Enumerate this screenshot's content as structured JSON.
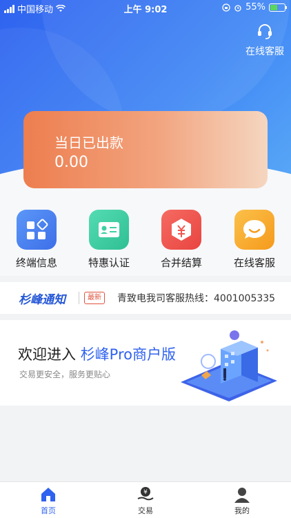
{
  "status_bar": {
    "carrier": "中国移动",
    "time": "上午 9:02",
    "battery": "55%",
    "battery_level": 0.55
  },
  "header": {
    "service_label": "在线客服"
  },
  "balance_card": {
    "title": "当日已出款",
    "amount": "0.00"
  },
  "quick_actions": [
    {
      "label": "终端信息",
      "icon": "grid-icon",
      "color": "#4e86f3"
    },
    {
      "label": "特惠认证",
      "icon": "id-card-icon",
      "color": "#3fcfa4"
    },
    {
      "label": "合并结算",
      "icon": "yuan-box-icon",
      "color": "#f0564f"
    },
    {
      "label": "在线客服",
      "icon": "smile-chat-icon",
      "color": "#f8ad2d"
    }
  ],
  "notice": {
    "brand": "杉峰通知",
    "badge": "最新",
    "text": "青致电我司客服热线：4001005335"
  },
  "banner": {
    "title_prefix": "欢迎进入 ",
    "title_accent": "杉峰Pro商户版",
    "subtitle": "交易更安全，服务更贴心"
  },
  "tab_bar": [
    {
      "label": "首页",
      "icon": "home-icon",
      "active": true
    },
    {
      "label": "交易",
      "icon": "money-hand-icon",
      "active": false
    },
    {
      "label": "我的",
      "icon": "user-icon",
      "active": false
    }
  ]
}
